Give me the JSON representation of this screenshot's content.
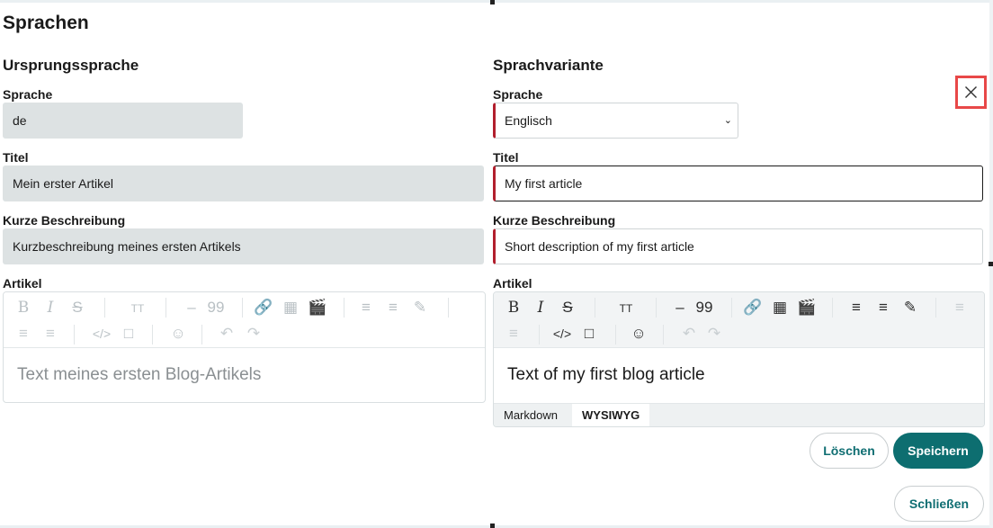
{
  "page": {
    "title": "Sprachen"
  },
  "origin": {
    "title": "Ursprungssprache",
    "language_label": "Sprache",
    "language_value": "de",
    "title_label": "Titel",
    "title_value": "Mein erster Artikel",
    "desc_label": "Kurze Beschreibung",
    "desc_value": "Kurzbeschreibung meines ersten Artikels",
    "article_label": "Artikel",
    "article_text": "Text meines ersten Blog-Artikels"
  },
  "variant": {
    "title": "Sprachvariante",
    "language_label": "Sprache",
    "language_value": "Englisch",
    "title_label": "Titel",
    "title_value": "My first article",
    "desc_label": "Kurze Beschreibung",
    "desc_value": "Short description of my first article",
    "article_label": "Artikel",
    "article_text": "Text of my first blog article",
    "tab_markdown": "Markdown",
    "tab_wysiwyg": "WYSIWYG"
  },
  "toolbar": {
    "bold": "B",
    "italic": "I",
    "strike": "S",
    "heading": "TT",
    "hr": "–",
    "quote": "99"
  },
  "buttons": {
    "delete": "Löschen",
    "save": "Speichern",
    "close": "Schließen"
  },
  "colors": {
    "accent": "#0d6e70",
    "required": "#b21f2d",
    "readonly_bg": "#dde2e3",
    "highlight": "#e84848"
  }
}
